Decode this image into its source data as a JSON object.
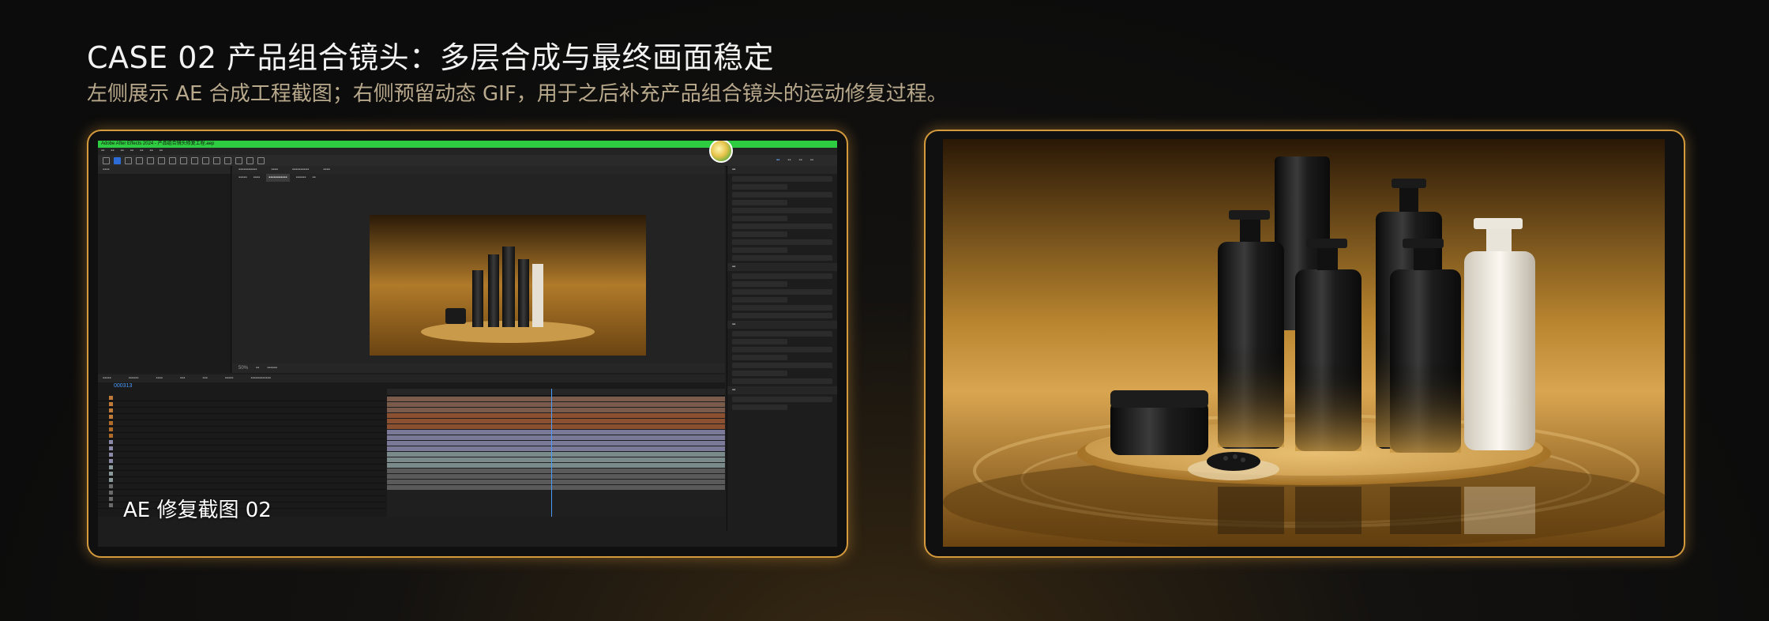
{
  "header": {
    "title": "CASE 02 产品组合镜头：多层合成与最终画面稳定",
    "subtitle": "左侧展示 AE 合成工程截图；右侧预留动态 GIF，用于之后补充产品组合镜头的运动修复过程。"
  },
  "left_panel": {
    "caption": "AE 修复截图 02",
    "app_title": "Adobe After Effects 2024 - 产品组合镜头修复工程.aep",
    "timecode": "000313",
    "zoom": "50%",
    "accent_color": "#d49a3c"
  },
  "right_panel": {
    "image_subject": "gold-cosmetic-product-render"
  },
  "colors": {
    "accent": "#d49a3c",
    "ae_titlebar": "#2ecc40",
    "playhead": "#4a9bff"
  }
}
